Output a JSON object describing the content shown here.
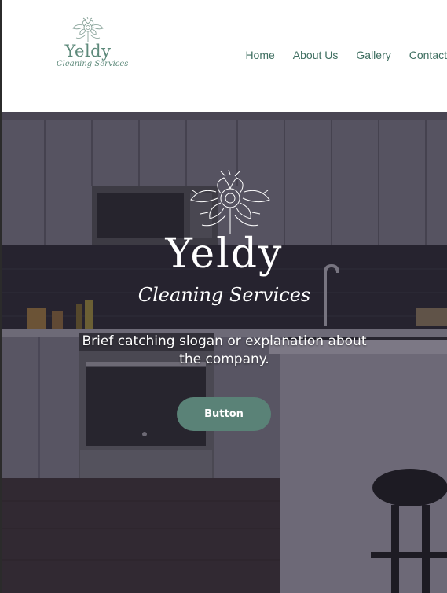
{
  "brand": {
    "name": "Yeldy",
    "tagline": "Cleaning Services",
    "accent_color": "#5a8277",
    "logo_icon": "flower-icon"
  },
  "nav": {
    "items": [
      {
        "label": "Home"
      },
      {
        "label": "About Us"
      },
      {
        "label": "Gallery"
      },
      {
        "label": "Contact"
      }
    ]
  },
  "hero": {
    "title": "Yeldy",
    "subtitle": "Cleaning Services",
    "slogan": "Brief catching slogan or explanation about the company.",
    "button_label": "Button",
    "background": "kitchen-photo"
  }
}
